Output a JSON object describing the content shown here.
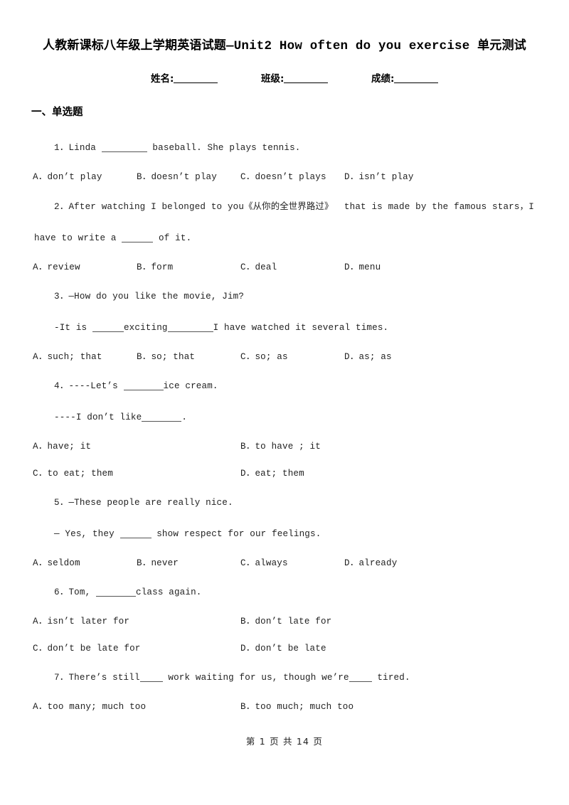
{
  "document": {
    "title_cjk_prefix": "人教新课标八年级上学期英语试题",
    "title_dash": "—",
    "title_latin": "Unit2 How often do you exercise",
    "title_cjk_suffix": "单元测试",
    "title_full": "人教新课标八年级上学期英语试题—Unit2 How often do you exercise 单元测试"
  },
  "identity": {
    "name_label": "姓名:",
    "class_label": "班级:",
    "score_label": "成绩:"
  },
  "sections": {
    "section1_heading": "一、单选题"
  },
  "questions": [
    {
      "number": "1",
      "stem_lines": [
        "1．Linda ________ baseball. She plays tennis."
      ],
      "stem_pre": "1．Linda ",
      "stem_post": " baseball. She plays tennis.",
      "layout": "four",
      "options": [
        "A．don’t play",
        "B．doesn’t play",
        "C．doesn’t plays",
        "D．isn’t play"
      ]
    },
    {
      "number": "2",
      "stem_line1_pre": "2．After watching I belonged to you",
      "stem_line1_book": "《从你的全世界路过》",
      "stem_line1_post": "that is made by the famous stars，I",
      "stem_line2_pre": "have to write a ",
      "stem_line2_post": " of it.",
      "layout": "four",
      "options": [
        "A．review",
        "B．form",
        "C．deal",
        "D．menu"
      ]
    },
    {
      "number": "3",
      "stem_line1": "3．—How do you like the movie, Jim?",
      "stem_line2_pre": "-It is ",
      "stem_line2_mid": "exciting",
      "stem_line2_post": "I have watched it several times.",
      "layout": "four",
      "options": [
        "A．such; that",
        "B．so; that",
        "C．so; as",
        "D．as; as"
      ]
    },
    {
      "number": "4",
      "stem_line1_pre": "4．----Let’s ",
      "stem_line1_post": "ice cream.",
      "stem_line2_pre": "----I don’t like",
      "stem_line2_post": ".",
      "layout": "two",
      "options": [
        "A．have; it",
        "B．to have ; it",
        "C．to eat; them",
        "D．eat; them"
      ]
    },
    {
      "number": "5",
      "stem_line1": "5．—These people are really nice.",
      "stem_line2_pre": "— Yes, they ",
      "stem_line2_post": " show respect for our feelings.",
      "layout": "four",
      "options": [
        "A．seldom",
        "B．never",
        "C．always",
        "D．already"
      ]
    },
    {
      "number": "6",
      "stem_pre": "6．Tom, ",
      "stem_post": "class again.",
      "layout": "two",
      "options": [
        "A．isn’t later for",
        "B．don’t late for",
        "C．don’t be late for",
        "D．don’t be late"
      ]
    },
    {
      "number": "7",
      "stem_pre": "7．There’s still",
      "stem_mid": " work waiting for us, though we’re",
      "stem_post": " tired.",
      "layout": "two",
      "options": [
        "A．too many; much too",
        "B．too much; much too"
      ]
    }
  ],
  "footer": {
    "text": "第 1 页 共 14 页",
    "current_page": "1",
    "total_pages": "14"
  }
}
